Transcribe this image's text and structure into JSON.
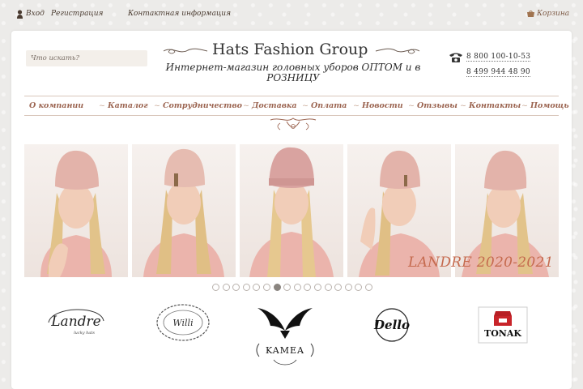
{
  "topbar": {
    "login": "Вход",
    "register": "Регистрация",
    "contact_info": "Контактная информация",
    "cart": "Корзина"
  },
  "search": {
    "placeholder": "Что искать?"
  },
  "header": {
    "title": "Hats Fashion Group",
    "subtitle": "Интернет-магазин головных уборов ОПТОМ и в РОЗНИЦУ",
    "phones": [
      "8 800 100-10-53",
      "8 499 944 48 90"
    ]
  },
  "nav": {
    "items": [
      {
        "label": "О компании"
      },
      {
        "label": "Каталог"
      },
      {
        "label": "Сотрудничество"
      },
      {
        "label": "Доставка"
      },
      {
        "label": "Оплата"
      },
      {
        "label": "Новости"
      },
      {
        "label": "Отзывы"
      },
      {
        "label": "Контакты"
      },
      {
        "label": "Помощь"
      }
    ]
  },
  "slider": {
    "caption": "LANDRE 2020-2021",
    "dot_count": 16,
    "active_dot_index": 6
  },
  "brands": {
    "landre_name": "Landre",
    "landre_tagline": "lucky hats",
    "willi_name": "Willi",
    "kamea_name": "KAMEA",
    "dello_name": "Dello",
    "tonak_name": "TONAK"
  },
  "colors": {
    "nav_text": "#9b6450",
    "caption": "#c56a4e",
    "hat_pink": "#e3b3aa",
    "sweater_pink": "#ebb4ac"
  }
}
